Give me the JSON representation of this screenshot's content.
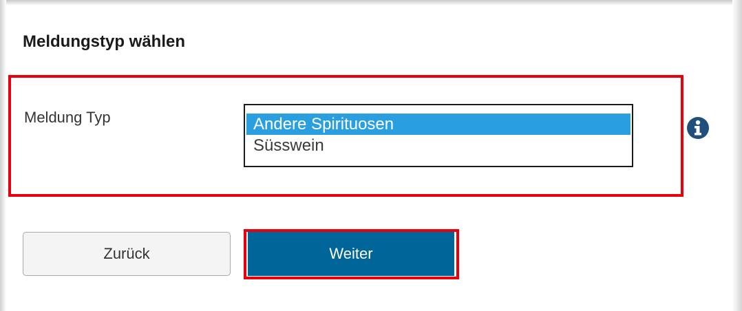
{
  "panel": {
    "title": "Meldungstyp wählen"
  },
  "field": {
    "label": "Meldung Typ",
    "options": [
      {
        "label": "Andere Spirituosen",
        "selected": true
      },
      {
        "label": "Süsswein",
        "selected": false
      }
    ]
  },
  "icons": {
    "info": "info-circle-icon"
  },
  "buttons": {
    "back_label": "Zurück",
    "next_label": "Weiter"
  },
  "colors": {
    "accent": "#006699",
    "selection": "#2a9fdf",
    "highlight": "#e8000d"
  }
}
